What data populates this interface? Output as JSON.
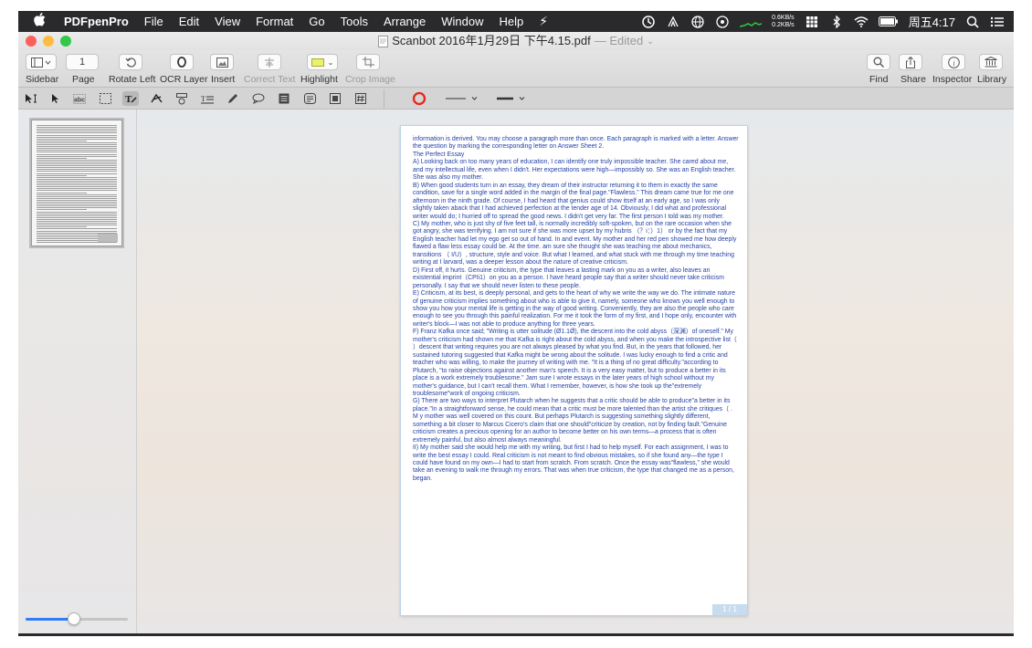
{
  "menubar": {
    "apple": "",
    "app_name": "PDFpenPro",
    "items": [
      "File",
      "Edit",
      "View",
      "Format",
      "Go",
      "Tools",
      "Arrange",
      "Window",
      "Help"
    ],
    "net_up": "0.6KB/s",
    "net_down": "0.2KB/s",
    "clock": "周五4:17"
  },
  "window": {
    "title": "Scanbot 2016年1月29日 下午4.15.pdf",
    "edited": "— Edited",
    "traffic_colors": {
      "close": "#fc605c",
      "minimize": "#fdbc40",
      "zoom": "#34c84a"
    }
  },
  "toolbar": {
    "page_value": "1",
    "labels": {
      "sidebar": "Sidebar",
      "page": "Page",
      "rotate_left": "Rotate Left",
      "ocr_layer": "OCR Layer",
      "insert": "Insert",
      "correct_text": "Correct Text",
      "highlight": "Highlight",
      "crop_image": "Crop Image",
      "find": "Find",
      "share": "Share",
      "inspector": "Inspector",
      "library": "Library"
    },
    "highlight_color": "#e9f26a"
  },
  "annotation_bar": {
    "ring_color": "#e8261c"
  },
  "sidebar": {
    "zoom_fraction": 0.47
  },
  "document": {
    "paragraphs": [
      "information is derived. You may choose a paragraph more than once. Each paragraph is marked with a letter. Answer the question by marking the corresponding letter on Answer Sheet 2.",
      "The Perfect Essay",
      "A) Looking back on too many years of education, I can identify one truly impossible teacher. She cared about me, and my intellectual life, even when I didn't. Her expectations were high—impossibly so. She was an English teacher. She was also my mother.",
      "B) When good students turn in an essay, they dream of their instructor returning it to them in exactly the same condition, save for a single word added in the margin of the final page.\"Flawless.\" This dream came true for me one afternoon in the ninth grade. Of course, I had heard that genius could show itself at an early age, so I was only slightly taken aback that I had achieved perfection at the tender age of 14. Obviously, I did what and professional writer would do; I hurried off to spread the good news. I didn't get very far. The first person I told was my mother.",
      "C) My mother, who is just shy of five feet tall, is normally incredibly soft-spoken, but on the rare occasion when she got angry, she was terrifying. I am not sure if she was more upset by my hubris （？i：）1） or by the fact that my English teacher had let my ego get so out of hand. In and event. My mother and her red pen showed me how deeply flawed a flaw less essay could be. At the time. am sure she thought she was teaching me about mechanics, transitions （ I/U）, structure, style and voice. But what I learned, and what stuck with me through my time teaching writing at I larvard, was a deeper lesson about the nature of creative criticism.",
      "D) First off, it hurts. Genuine criticism, the type that leaves a lasting mark on you as a writer, also leaves an existential imprint（CPIi1）on you as a person. I have heard people say that a writer should never take criticism personally. I say that we should never listen to these people.",
      "E) Criticism, at its best, is deeply personal, and gets to the heart of why we write the way we do. The intimate nature of genuine criticism implies something about who is able to give it, namely, someone who knows you well enough to show you how your mental life is getting in the way of good writing. Conveniently, they are also the people who care enough to see you through this painful realization. For me it took the form of my first, and I hope only, encounter with writer's block—I was not able to produce anything for three years.",
      "F) Franz Kafka once said; \"Writing is utter solitude (Ø1.1Ǿ), the descent into the cold abyss（深渊）of oneself.\" My mother's criticism had shown me that Kafka is right about the cold abyss, and when you make the introspective list（ ）descent that writing requires you are not always pleased by what you find. But, in the years that followed, her sustained tutoring suggested that Kafka might be wrong about the solitude. I was lucky enough to find a critic and teacher who was willing, to make the journey of writing with me. \"It is a thing of no great difficulty.\"according to Plutarch, \"to raise objections against another man's speech. It is a very easy matter, but to produce a better in its place is a work extremely troublesome.\" Jam sure I wrote essays in the later years of high school without my mother's guidance, but I can't recall them. What I remember, however, is how she took up the\"extremely troublesome\"work of ongoing criticism.",
      "G) There are two ways to interpret Plutarch when he suggests that a critic should be able to produce\"a better in its place.\"In a straightforward sense, he could mean that a critic must be more talented than the artist she critiques（ . M y mother was well covered on this count. But perhaps Plutarch is suggesting something slightly different, something a bit closer to Marcus Cicero's claim that one should\"criticize by creation, not by finding fault.\"Genuine criticism creates a precious opening for an author to become better on his own terms—a process that is often extremely painful, but also almost always meaningful.",
      "II) My mother said she would help me with my writing, but first I had to help myself. For each assignment, I was to write the best essay I could. Real criticism is not meant to find obvious mistakes, so if she found any—the type I could have found on my own—I had to start from scratch. From scratch. Once the essay was\"flawless,\" she would take an evening to walk me through my errors. That was when true criticism, the type that changed me as a person, began."
    ],
    "page_badge": "1 / 1"
  }
}
